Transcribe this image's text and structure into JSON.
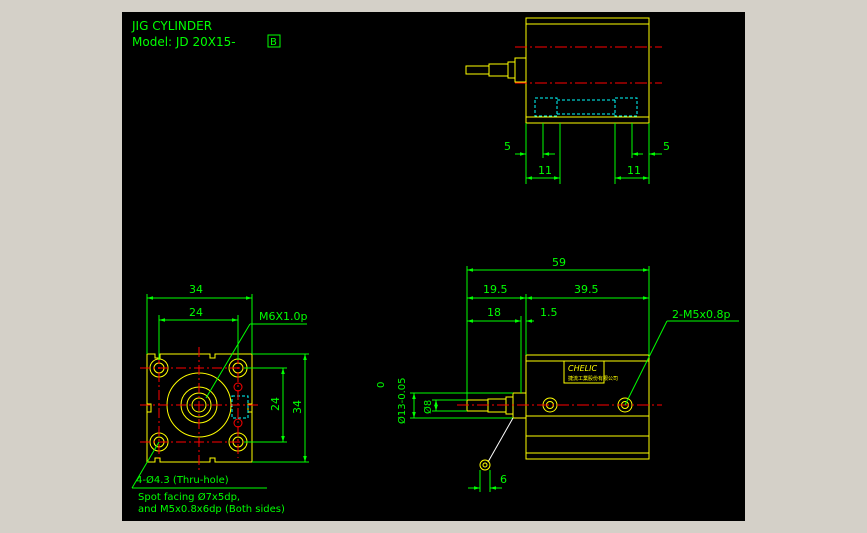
{
  "title": "JIG CYLINDER",
  "model": "Model: JD 20X15-",
  "model_suffix": "B",
  "front": {
    "width_outer": "34",
    "width_inner": "24",
    "thread": "M6X1.0p",
    "height_inner": "24",
    "height_outer": "34",
    "holes": "4-Ø4.3 (Thru-hole)",
    "spot1": "Spot facing Ø7x5dp,",
    "spot2": "and M5x0.8x6dp (Both sides)"
  },
  "top": {
    "dim_left_5": "5",
    "dim_right_5": "5",
    "dim_left_11": "11",
    "dim_right_11": "11"
  },
  "side": {
    "overall": "59",
    "d195": "19.5",
    "d395": "39.5",
    "d18": "18",
    "d15": "1.5",
    "ports": "2-M5x0.8p",
    "tol_top": "0",
    "tol_bottom": "Ø13-0.05",
    "rod": "Ø8",
    "d6": "6",
    "label_brand": "CHELIC",
    "label_sub": "捷流工業股份有限公司"
  },
  "colors": {
    "background": "#000000",
    "dimension": "#00ff00",
    "body": "#ffff00",
    "hidden": "#00ffff",
    "centerline": "#ff0000",
    "leader": "#ffffff",
    "frame": "#d4d0c8"
  }
}
